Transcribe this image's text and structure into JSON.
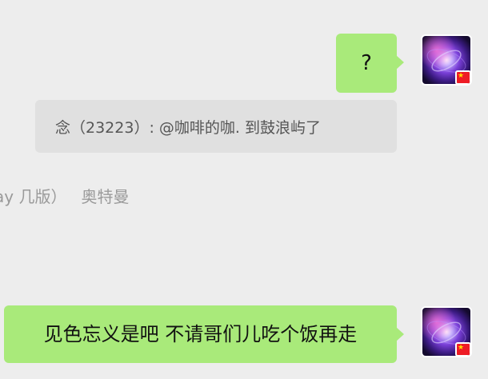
{
  "messages": {
    "question_text": "?",
    "quote_text": "念（23223）: @咖啡的咖. 到鼓浪屿了",
    "system_fragment": "ay 几版）",
    "system_name": "奥特曼",
    "last_text": "见色忘义是吧 不请哥们儿吃个饭再走"
  },
  "avatar": {
    "icon": "galaxy-avatar-icon",
    "flag_icon": "china-flag-icon",
    "flag_star": "★"
  },
  "colors": {
    "background": "#ededed",
    "outgoing_bubble": "#a9ea7a",
    "quote_bg": "#e0e0e0",
    "flag_red": "#ee1c25",
    "flag_yellow": "#ffde00"
  }
}
